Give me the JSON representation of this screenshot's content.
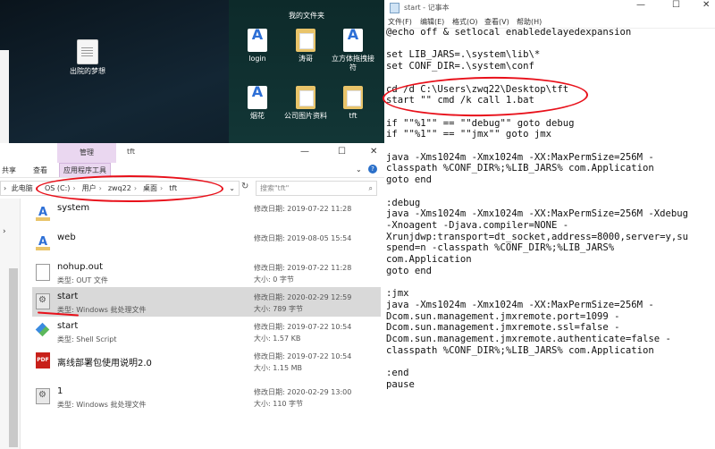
{
  "desktop": {
    "icons": [
      {
        "label": "出院的梦想",
        "kind": "doc"
      },
      {
        "label": "login",
        "kind": "chrome"
      },
      {
        "label": "涛哥",
        "kind": "folder"
      },
      {
        "label": "立方体拖拽接符",
        "kind": "chrome"
      },
      {
        "label": "烟花",
        "kind": "chrome"
      },
      {
        "label": "公司图片资料",
        "kind": "folder"
      },
      {
        "label": "tft",
        "kind": "folder"
      }
    ],
    "folder_panel_title": "我的文件夹"
  },
  "explorer": {
    "context_tab": "管理",
    "window_title": "tft",
    "ribbon_tabs": [
      "共享",
      "查看",
      "应用程序工具"
    ],
    "breadcrumb": [
      "此电脑",
      "OS (C:)",
      "用户",
      "zwq22",
      "桌面",
      "tft"
    ],
    "search_placeholder": "搜索\"tft\"",
    "files": [
      {
        "name": "system",
        "type": "",
        "date": "修改日期: 2019-07-22 11:28",
        "size": "",
        "icon": "chrome-icon",
        "selected": false
      },
      {
        "name": "web",
        "type": "",
        "date": "修改日期: 2019-08-05 15:54",
        "size": "",
        "icon": "chrome-icon",
        "selected": false
      },
      {
        "name": "nohup.out",
        "type": "类型: OUT 文件",
        "date": "修改日期: 2019-07-22 11:28",
        "size": "大小: 0 字节",
        "icon": "file-icon",
        "selected": false
      },
      {
        "name": "start",
        "type": "类型: Windows 批处理文件",
        "date": "修改日期: 2020-02-29 12:59",
        "size": "大小: 789 字节",
        "icon": "batch-file-icon",
        "selected": true
      },
      {
        "name": "start",
        "type": "类型: Shell Script",
        "date": "修改日期: 2019-07-22 10:54",
        "size": "大小: 1.57 KB",
        "icon": "shell-script-icon",
        "selected": false
      },
      {
        "name": "离线部署包使用说明2.0",
        "type": "",
        "date": "修改日期: 2019-07-22 10:54",
        "size": "大小: 1.15 MB",
        "icon": "pdf-icon",
        "selected": false
      },
      {
        "name": "1",
        "type": "类型: Windows 批处理文件",
        "date": "修改日期: 2020-02-29 13:00",
        "size": "大小: 110 字节",
        "icon": "batch-file-icon",
        "selected": false
      }
    ]
  },
  "notepad": {
    "title": "start - 记事本",
    "menu": [
      "文件(F)",
      "编辑(E)",
      "格式(O)",
      "查看(V)",
      "帮助(H)"
    ],
    "content": "@echo off & setlocal enabledelayedexpansion\n\nset LIB_JARS=.\\system\\lib\\*\nset CONF_DIR=.\\system\\conf\n\ncd /d C:\\Users\\zwq22\\Desktop\\tft\nstart \"\" cmd /k call 1.bat\n\nif \"\"%1\"\" == \"\"debug\"\" goto debug\nif \"\"%1\"\" == \"\"jmx\"\" goto jmx\n\njava -Xms1024m -Xmx1024m -XX:MaxPermSize=256M -\nclasspath %CONF_DIR%;%LIB_JARS% com.Application\ngoto end\n\n:debug\njava -Xms1024m -Xmx1024m -XX:MaxPermSize=256M -Xdebug\n-Xnoagent -Djava.compiler=NONE -\nXrunjdwp:transport=dt_socket,address=8000,server=y,su\nspend=n -classpath %CONF_DIR%;%LIB_JARS%\ncom.Application\ngoto end\n\n:jmx\njava -Xms1024m -Xmx1024m -XX:MaxPermSize=256M -\nDcom.sun.management.jmxremote.port=1099 -\nDcom.sun.management.jmxremote.ssl=false -\nDcom.sun.management.jmxremote.authenticate=false -\nclasspath %CONF_DIR%;%LIB_JARS% com.Application\n\n:end\npause"
  }
}
